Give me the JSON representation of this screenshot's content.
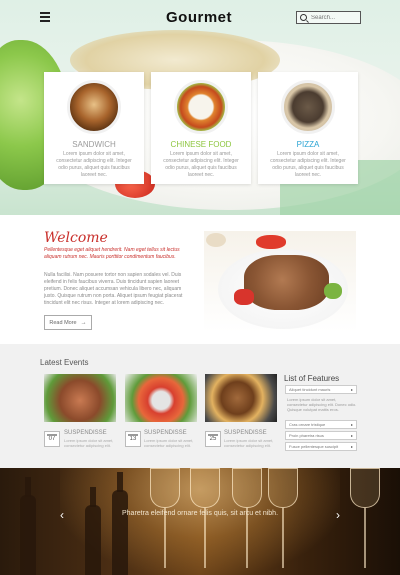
{
  "header": {
    "logo": "Gourmet",
    "search_placeholder": "Search..."
  },
  "cards": [
    {
      "title": "SANDWICH",
      "desc": "Lorem ipsum dolor sit amet, consectetur adipiscing elit. Integer odio purus, aliquet quis faucibus laoreet nec."
    },
    {
      "title": "CHINESE FOOD",
      "desc": "Lorem ipsum dolor sit amet, consectetur adipiscing elit. Integer odio purus, aliquet quis faucibus laoreet nec."
    },
    {
      "title": "PIZZA",
      "desc": "Lorem ipsum dolor sit amet, consectetur adipiscing elit. Integer odio purus, aliquet quis faucibus laoreet nec."
    }
  ],
  "welcome": {
    "title": "Welcome",
    "intro": "Pellentesque eget aliquet hendrerit. Nam eget tellus sit lectus aliquam rutrum nec. Mauris porttitor condimentum faucibus.",
    "body": "Nulla facilisi. Nam posuere tortor non sapien sodales vel. Duis eleifend in felis faucibus viverra. Duis tincidunt sapien laoreet pretium. Donec aliquet accumsan vehicula libero nec, aliquam justo. Quisque rutrum non porta. Aliquet ipsum feugiat placerat tincidunt elit nec risus. Integer at lorem adipiscing nec.",
    "read_more": "Read More"
  },
  "events": {
    "title": "Latest Events",
    "items": [
      {
        "day": "07",
        "title": "SUSPENDISSE",
        "desc": "Lorem ipsum dolor sit amet, consectetur adipiscing elit."
      },
      {
        "day": "13",
        "title": "SUSPENDISSE",
        "desc": "Lorem ipsum dolor sit amet, consectetur adipiscing elit."
      },
      {
        "day": "25",
        "title": "SUSPENDISSE",
        "desc": "Lorem ipsum dolor sit amet, consectetur adipiscing elit."
      }
    ]
  },
  "features": {
    "title": "List of Features",
    "items": [
      "Aliquet tincidunt mauris",
      "Cras ornare tristique",
      "Proin pharetra risus",
      "Fusce pellentesque suscipit"
    ],
    "text": "Lorem ipsum dolor sit amet, consectetur adipiscing elit. Donec odio. Quisque volutpat mattis eros."
  },
  "slider": {
    "caption": "Pharetra eleifend ornare felis quis, sit arcu et nibh.",
    "prev": "‹",
    "next": "›"
  }
}
